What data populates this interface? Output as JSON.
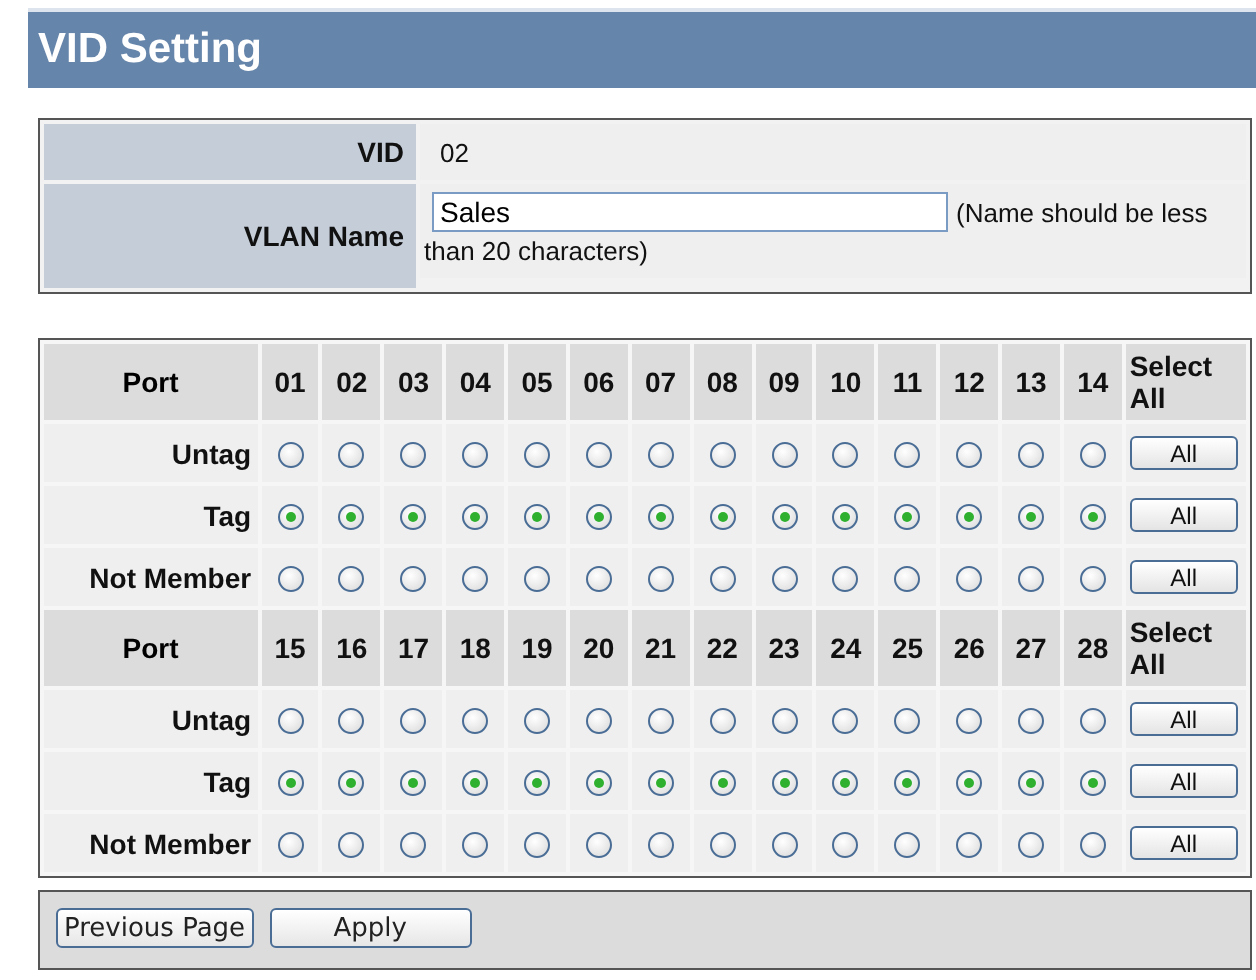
{
  "title": "VID Setting",
  "settings": {
    "vid_label": "VID",
    "vid": "02",
    "name_label": "VLAN Name",
    "name_value": "Sales",
    "name_hint_lines": [
      "(Name should be less",
      "than 20 characters)"
    ]
  },
  "groups": [
    {
      "port_label": "Port",
      "select_all_label": "Select All",
      "ports": [
        "01",
        "02",
        "03",
        "04",
        "05",
        "06",
        "07",
        "08",
        "09",
        "10",
        "11",
        "12",
        "13",
        "14"
      ],
      "rows": [
        {
          "label": "Untag",
          "button": "All",
          "radios": [
            {
              "selected": false
            },
            {
              "selected": false
            },
            {
              "selected": false
            },
            {
              "selected": false
            },
            {
              "selected": false
            },
            {
              "selected": false
            },
            {
              "selected": false
            },
            {
              "selected": false
            },
            {
              "selected": false
            },
            {
              "selected": false
            },
            {
              "selected": false
            },
            {
              "selected": false
            },
            {
              "selected": false
            },
            {
              "selected": false
            }
          ]
        },
        {
          "label": "Tag",
          "button": "All",
          "radios": [
            {
              "selected": true
            },
            {
              "selected": true
            },
            {
              "selected": true
            },
            {
              "selected": true
            },
            {
              "selected": true
            },
            {
              "selected": true
            },
            {
              "selected": true
            },
            {
              "selected": true
            },
            {
              "selected": true
            },
            {
              "selected": true
            },
            {
              "selected": true
            },
            {
              "selected": true
            },
            {
              "selected": true
            },
            {
              "selected": true
            }
          ]
        },
        {
          "label": "Not Member",
          "button": "All",
          "radios": [
            {
              "selected": false
            },
            {
              "selected": false
            },
            {
              "selected": false
            },
            {
              "selected": false
            },
            {
              "selected": false
            },
            {
              "selected": false
            },
            {
              "selected": false
            },
            {
              "selected": false
            },
            {
              "selected": false
            },
            {
              "selected": false
            },
            {
              "selected": false
            },
            {
              "selected": false
            },
            {
              "selected": false
            },
            {
              "selected": false
            }
          ]
        }
      ]
    },
    {
      "port_label": "Port",
      "select_all_label": "Select All",
      "ports": [
        "15",
        "16",
        "17",
        "18",
        "19",
        "20",
        "21",
        "22",
        "23",
        "24",
        "25",
        "26",
        "27",
        "28"
      ],
      "rows": [
        {
          "label": "Untag",
          "button": "All",
          "radios": [
            {
              "selected": false
            },
            {
              "selected": false
            },
            {
              "selected": false
            },
            {
              "selected": false
            },
            {
              "selected": false
            },
            {
              "selected": false
            },
            {
              "selected": false
            },
            {
              "selected": false
            },
            {
              "selected": false
            },
            {
              "selected": false
            },
            {
              "selected": false
            },
            {
              "selected": false
            },
            {
              "selected": false
            },
            {
              "selected": false
            }
          ]
        },
        {
          "label": "Tag",
          "button": "All",
          "radios": [
            {
              "selected": true
            },
            {
              "selected": true
            },
            {
              "selected": true
            },
            {
              "selected": true
            },
            {
              "selected": true
            },
            {
              "selected": true
            },
            {
              "selected": true
            },
            {
              "selected": true
            },
            {
              "selected": true
            },
            {
              "selected": true
            },
            {
              "selected": true
            },
            {
              "selected": true
            },
            {
              "selected": true
            },
            {
              "selected": true
            }
          ]
        },
        {
          "label": "Not Member",
          "button": "All",
          "radios": [
            {
              "selected": false
            },
            {
              "selected": false
            },
            {
              "selected": false
            },
            {
              "selected": false
            },
            {
              "selected": false
            },
            {
              "selected": false
            },
            {
              "selected": false
            },
            {
              "selected": false
            },
            {
              "selected": false
            },
            {
              "selected": false
            },
            {
              "selected": false
            },
            {
              "selected": false
            },
            {
              "selected": false
            },
            {
              "selected": false
            }
          ]
        }
      ]
    }
  ],
  "buttons": [
    "Previous Page",
    "Apply"
  ]
}
